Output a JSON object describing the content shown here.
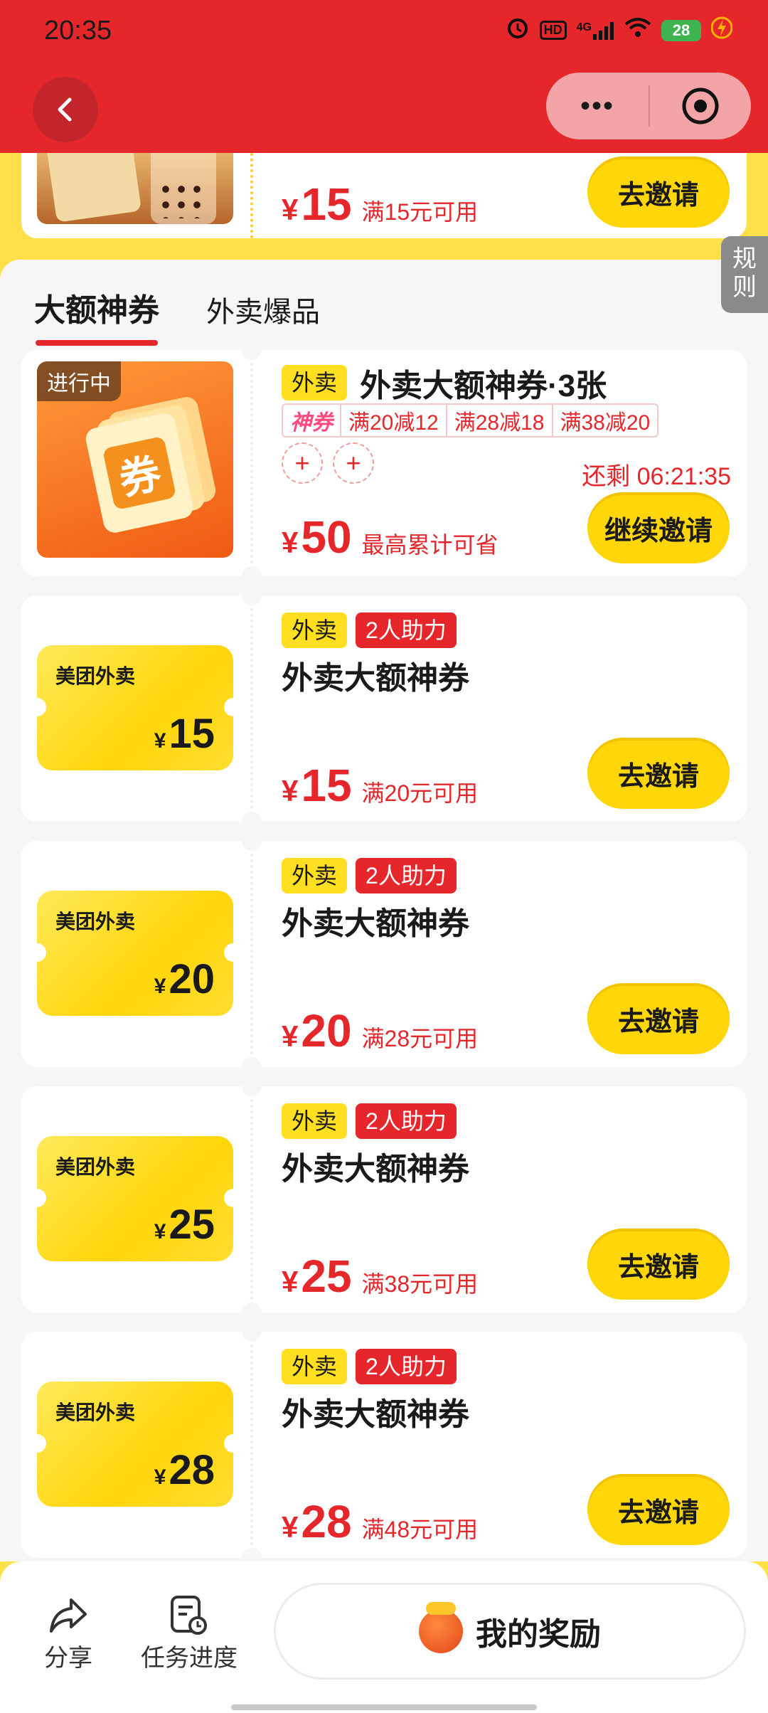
{
  "status": {
    "time": "20:35",
    "battery": "28",
    "network": "4G",
    "hd": "HD"
  },
  "nav": {
    "more": "•••"
  },
  "top_card": {
    "yen": "¥",
    "amount": "15",
    "condition": "满15元可用",
    "button": "去邀请"
  },
  "rules_tab": "规则",
  "tabs": [
    {
      "label": "大额神券"
    },
    {
      "label": "外卖爆品"
    }
  ],
  "featured": {
    "badge": "进行中",
    "art_char": "券",
    "tag": "外卖",
    "title": "外卖大额神券·3张",
    "promo_label": "神券",
    "promos": [
      "满20减12",
      "满28减18",
      "满38减20"
    ],
    "add": "+",
    "countdown": "还剩 06:21:35",
    "yen": "¥",
    "amount": "50",
    "condition": "最高累计可省",
    "button": "继续邀请"
  },
  "coupons": [
    {
      "brand": "美团外卖",
      "tag1": "外卖",
      "tag2": "2人助力",
      "title": "外卖大额神券",
      "yen": "¥",
      "face": "15",
      "amount": "15",
      "condition": "满20元可用",
      "button": "去邀请"
    },
    {
      "brand": "美团外卖",
      "tag1": "外卖",
      "tag2": "2人助力",
      "title": "外卖大额神券",
      "yen": "¥",
      "face": "20",
      "amount": "20",
      "condition": "满28元可用",
      "button": "去邀请"
    },
    {
      "brand": "美团外卖",
      "tag1": "外卖",
      "tag2": "2人助力",
      "title": "外卖大额神券",
      "yen": "¥",
      "face": "25",
      "amount": "25",
      "condition": "满38元可用",
      "button": "去邀请"
    },
    {
      "brand": "美团外卖",
      "tag1": "外卖",
      "tag2": "2人助力",
      "title": "外卖大额神券",
      "yen": "¥",
      "face": "28",
      "amount": "28",
      "condition": "满48元可用",
      "button": "去邀请"
    }
  ],
  "bottom": {
    "share": "分享",
    "tasks": "任务进度",
    "reward": "我的奖励"
  }
}
